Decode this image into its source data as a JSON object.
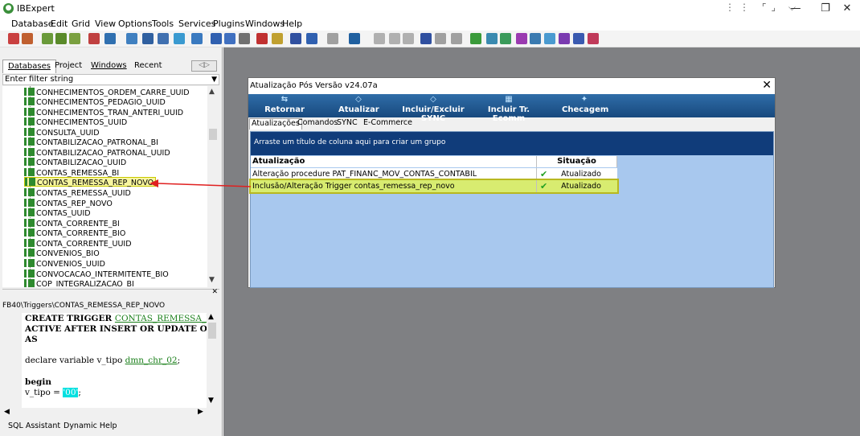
{
  "app": {
    "title": "IBExpert",
    "window_controls": {
      "minimize": "—",
      "maximize": "❐",
      "close": "✕"
    },
    "extra_icons": "⋮⋮ ⌜⌟ ⌵"
  },
  "menu": {
    "items": [
      "Database",
      "Edit",
      "Grid",
      "View",
      "Options",
      "Tools",
      "Services",
      "Plugins",
      "Windows",
      "Help"
    ]
  },
  "left_panel": {
    "tabs": [
      "Databases",
      "Project",
      "Windows",
      "Recent"
    ],
    "filter_placeholder": "Enter filter string",
    "tree_items": [
      "CONHECIMENTOS_ORDEM_CARRE_UUID",
      "CONHECIMENTOS_PEDAGIO_UUID",
      "CONHECIMENTOS_TRAN_ANTERI_UUID",
      "CONHECIMENTOS_UUID",
      "CONSULTA_UUID",
      "CONTABILIZACAO_PATRONAL_BI",
      "CONTABILIZACAO_PATRONAL_UUID",
      "CONTABILIZACAO_UUID",
      "CONTAS_REMESSA_BI",
      "CONTAS_REMESSA_REP_NOVO",
      "CONTAS_REMESSA_UUID",
      "CONTAS_REP_NOVO",
      "CONTAS_UUID",
      "CONTA_CORRENTE_BI",
      "CONTA_CORRENTE_BIO",
      "CONTA_CORRENTE_UUID",
      "CONVENIOS_BIO",
      "CONVENIOS_UUID",
      "CONVOCACAO_INTERMITENTE_BIO",
      "COP_INTEGRALIZACAO_BI"
    ],
    "selected_index": 9,
    "editor_path": "FB40\\Triggers\\CONTAS_REMESSA_REP_NOVO",
    "code": {
      "l1_kw": "CREATE TRIGGER ",
      "l1_name": "CONTAS_REMESSA_REP_NO",
      "l2": "ACTIVE AFTER INSERT OR UPDATE OR DEL",
      "l3": "AS",
      "l4_a": "declare variable v_tipo ",
      "l4_type": "dmn_chr_02",
      "l4_b": ";",
      "l5": "begin",
      "l6_a": "   v_tipo = ",
      "l6_val": "'00'",
      "l6_b": ";"
    },
    "bottom_tabs": [
      "SQL Assistant",
      "Dynamic Help"
    ]
  },
  "dialog": {
    "title": "Atualização Pós Versão v24.07a",
    "close": "✕",
    "buttons": [
      "Retornar",
      "Atualizar",
      "Incluir/Excluir SYNC",
      "Incluir Tr. Ecomm",
      "Checagem"
    ],
    "button_icons": [
      "⇆",
      "◇",
      "◇",
      "▦",
      "✦"
    ],
    "tabs": [
      "Atualizações",
      "Comandos",
      "SYNC",
      "E-Commerce"
    ],
    "group_hint": "Arraste um título de coluna aqui para criar um grupo",
    "columns": [
      "Atualização",
      "Situação"
    ],
    "rows": [
      {
        "atualizacao": "Alteração procedure PAT_FINANC_MOV_CONTAS_CONTABIL",
        "situacao": "Atualizado",
        "check": "✔"
      },
      {
        "atualizacao": "Inclusão/Alteração Trigger contas_remessa_rep_novo",
        "situacao": "Atualizado",
        "check": "✔"
      }
    ]
  },
  "colors": {
    "highlight_yellow": "#f8f6a0",
    "row_highlight": "#d8ec70",
    "arrow_red": "#e02020",
    "dialog_toolbar": "#1f5a92",
    "grid_background": "#a8c8ee"
  }
}
